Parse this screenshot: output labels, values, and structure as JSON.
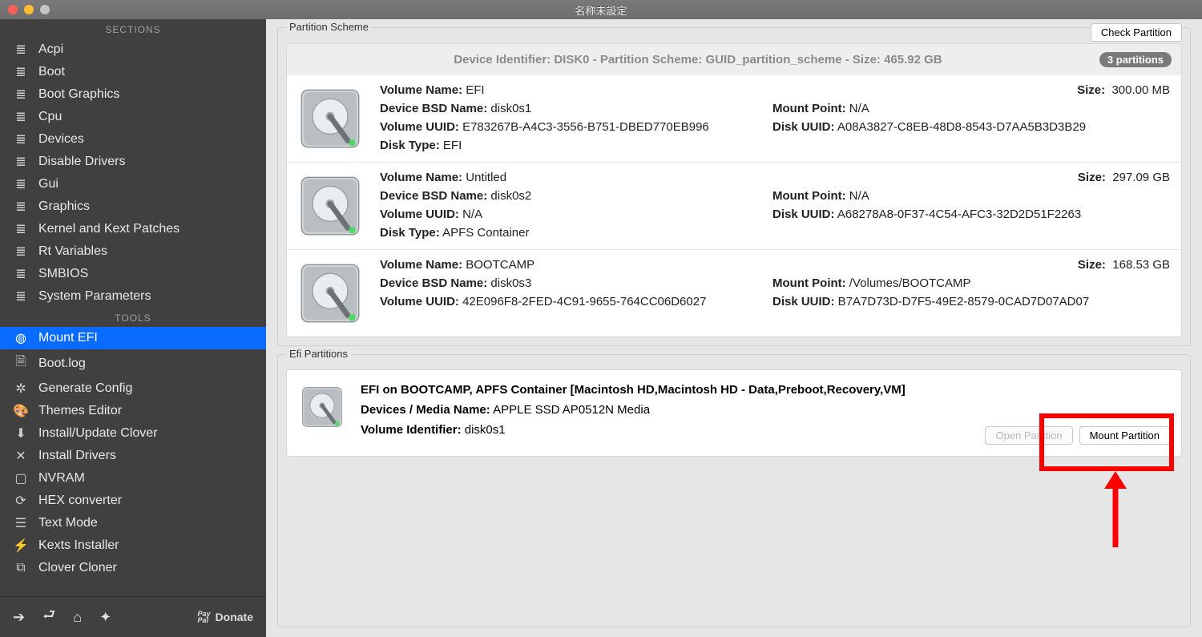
{
  "window": {
    "title": "名称未設定"
  },
  "sidebar": {
    "hdr_sections": "SECTIONS",
    "hdr_tools": "TOOLS",
    "sections": [
      {
        "label": "Acpi",
        "icon": "list"
      },
      {
        "label": "Boot",
        "icon": "list"
      },
      {
        "label": "Boot Graphics",
        "icon": "list"
      },
      {
        "label": "Cpu",
        "icon": "list"
      },
      {
        "label": "Devices",
        "icon": "list"
      },
      {
        "label": "Disable Drivers",
        "icon": "list"
      },
      {
        "label": "Gui",
        "icon": "list"
      },
      {
        "label": "Graphics",
        "icon": "list"
      },
      {
        "label": "Kernel and Kext Patches",
        "icon": "list"
      },
      {
        "label": "Rt Variables",
        "icon": "list"
      },
      {
        "label": "SMBIOS",
        "icon": "list"
      },
      {
        "label": "System Parameters",
        "icon": "list"
      }
    ],
    "tools": [
      {
        "label": "Mount EFI",
        "icon": "disk",
        "selected": true
      },
      {
        "label": "Boot.log",
        "icon": "doc"
      },
      {
        "label": "Generate Config",
        "icon": "gear"
      },
      {
        "label": "Themes Editor",
        "icon": "palette"
      },
      {
        "label": "Install/Update Clover",
        "icon": "download"
      },
      {
        "label": "Install Drivers",
        "icon": "wrench"
      },
      {
        "label": "NVRAM",
        "icon": "chip"
      },
      {
        "label": "HEX converter",
        "icon": "refresh"
      },
      {
        "label": "Text Mode",
        "icon": "text"
      },
      {
        "label": "Kexts Installer",
        "icon": "plug"
      },
      {
        "label": "Clover Cloner",
        "icon": "clone"
      }
    ],
    "donate": "Donate"
  },
  "partition_scheme": {
    "title": "Partition Scheme",
    "check_btn": "Check Partition",
    "header": "Device Identifier: DISK0 - Partition Scheme: GUID_partition_scheme - Size: 465.92 GB",
    "badge": "3 partitions",
    "labels": {
      "vol_name": "Volume Name:",
      "size": "Size:",
      "bsd": "Device BSD Name:",
      "mount": "Mount Point:",
      "vuuid": "Volume UUID:",
      "duuid": "Disk UUID:",
      "dtype": "Disk Type:"
    },
    "volumes": [
      {
        "name": "EFI",
        "size": "300.00 MB",
        "bsd": "disk0s1",
        "mount": "N/A",
        "vuuid": "E783267B-A4C3-3556-B751-DBED770EB996",
        "duuid": "A08A3827-C8EB-48D8-8543-D7AA5B3D3B29",
        "dtype": "EFI"
      },
      {
        "name": "Untitled",
        "size": "297.09 GB",
        "bsd": "disk0s2",
        "mount": "N/A",
        "vuuid": "N/A",
        "duuid": "A68278A8-0F37-4C54-AFC3-32D2D51F2263",
        "dtype": "APFS Container"
      },
      {
        "name": "BOOTCAMP",
        "size": "168.53 GB",
        "bsd": "disk0s3",
        "mount": "/Volumes/BOOTCAMP",
        "vuuid": "42E096F8-2FED-4C91-9655-764CC06D6027",
        "duuid": "B7A7D73D-D7F5-49E2-8579-0CAD7D07AD07",
        "dtype": ""
      }
    ]
  },
  "efi_partitions": {
    "title": "Efi Partitions",
    "headline": "EFI on BOOTCAMP, APFS Container [Macintosh HD,Macintosh HD - Data,Preboot,Recovery,VM]",
    "media_label": "Devices / Media Name:",
    "media_value": "APPLE SSD AP0512N Media",
    "volid_label": "Volume Identifier:",
    "volid_value": "disk0s1",
    "open_btn": "Open Partition",
    "mount_btn": "Mount Partition"
  },
  "annotation": {
    "color": "#ff0000"
  }
}
